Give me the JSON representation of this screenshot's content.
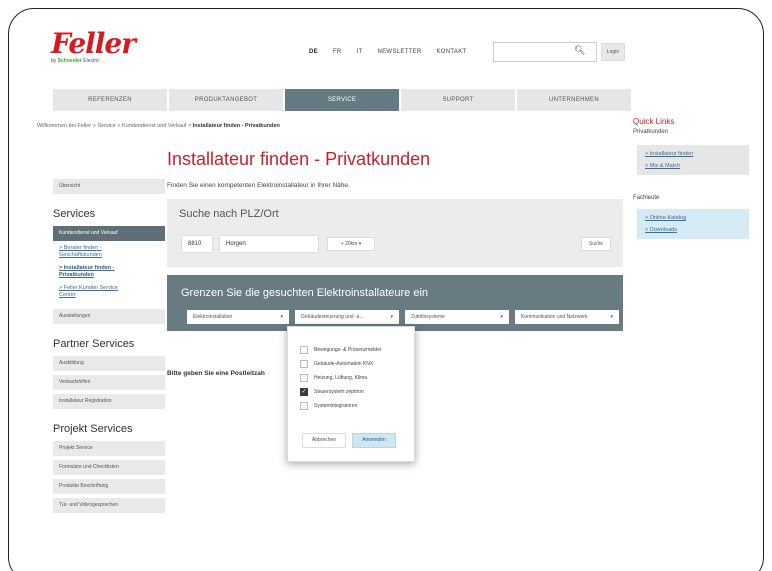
{
  "brand": {
    "logo_text": "Feller",
    "logo_sub_prefix": "by ",
    "logo_sub_brand": "Schneider",
    "logo_sub_suffix": " Electric",
    "accent": "#d71920"
  },
  "topnav": {
    "lang_de": "DE",
    "lang_fr": "FR",
    "lang_it": "IT",
    "newsletter": "NEWSLETTER",
    "kontakt": "KONTAKT",
    "search_value": "",
    "login": "Login"
  },
  "mainnav": {
    "tabs": [
      "REFERENZEN",
      "PRODUKTANGEBOT",
      "SERVICE",
      "SUPPORT",
      "UNTERNEHMEN"
    ],
    "active": "SERVICE",
    "active_color": "#657b84"
  },
  "breadcrumb": {
    "path": "Willkommen bei Feller > Service > Kundendienst und Verkauf > ",
    "current": "Installateur finden - Privatkunden"
  },
  "sidebar": {
    "overview": "Übersicht",
    "services_heading": "Services",
    "kundendienst": "Kundendienst und Verkauf",
    "link1_line1": "> Berater finden -",
    "link1_line2": "Geschäftskunden",
    "link2_line1": "> Installateur finden -",
    "link2_line2": "Privatkunden",
    "link3_line1": "> Feller Kunden Service",
    "link3_line2": "Center",
    "ausstellungen": "Ausstellungen",
    "partner_heading": "Partner Services",
    "ausbildung": "Ausbildung",
    "verkaufshilfen": "Verkaufshilfen",
    "installateur_reg": "Installateur Registration",
    "projekt_heading": "Projekt Services",
    "projekt_service": "Projekt Service",
    "formulare": "Formulare und Checklisten",
    "produkte": "Produkte Beschriftung",
    "tuer": "Tür- und Videogesprechen"
  },
  "main": {
    "title": "Installateur finden - Privatkunden",
    "subtitle": "Finden Sie einen kompetenten Elektroinstallateur in Ihrer Nähe.",
    "search_title": "Suche nach PLZ/Ort",
    "plz": "8810",
    "ort": "Horgen",
    "radius": "+ 20km",
    "suche": "Suche",
    "filter_title": "Grenzen Sie die gesuchten Elektroinstallateure ein",
    "filters": [
      "Elektroinstallation",
      "Gebäudesteuerung und -a...",
      "Zutrittssysteme",
      "Kommunikation und Netzwerk"
    ],
    "postal_msg": "Bitte geben Sie eine Postleitzah"
  },
  "dropdown": {
    "options": [
      {
        "label": "Bewegungs- & Präsenzmelder",
        "checked": false
      },
      {
        "label": "Gebäude-Automation KNX",
        "checked": false
      },
      {
        "label": "Heizung, Lüftung, Klima",
        "checked": false
      },
      {
        "label": "Steuersystem zeptrion",
        "checked": true
      },
      {
        "label": "Systemintegratoren",
        "checked": false
      }
    ],
    "cancel": "Abbrechen",
    "apply": "Anwenden"
  },
  "quicklinks": {
    "title": "Quick Links",
    "privat_label": "Privatkunden",
    "privat_links": [
      "> Installateur finden",
      "> Mix & Match"
    ],
    "fach_label": "Fachleute",
    "fach_links": [
      "> Online-Katalog",
      "> Downloads"
    ]
  }
}
